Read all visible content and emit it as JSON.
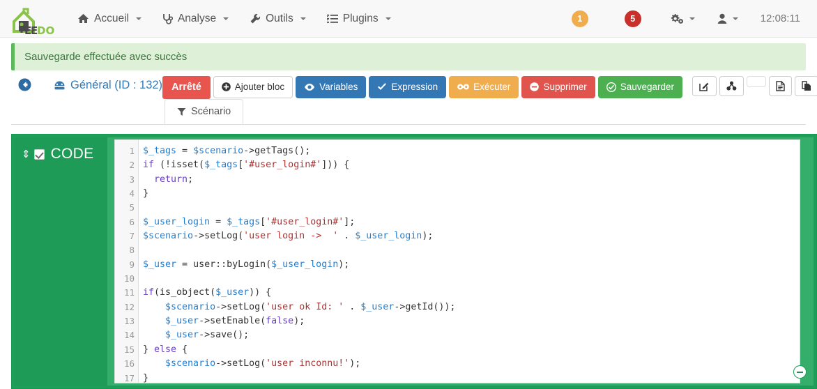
{
  "navbar": {
    "brand": "JEEDOM",
    "brand_part1": "J",
    "brand_part2": "EE",
    "brand_part3": "DOM",
    "items": [
      {
        "label": "Accueil",
        "icon": "home-icon"
      },
      {
        "label": "Analyse",
        "icon": "stethoscope-icon"
      },
      {
        "label": "Outils",
        "icon": "wrench-icon"
      },
      {
        "label": "Plugins",
        "icon": "list-icon"
      }
    ],
    "badges": [
      {
        "value": "1",
        "color": "#f0ad4e",
        "name": "warning-badge"
      },
      {
        "value": "5",
        "color": "#c9302c",
        "name": "error-badge"
      }
    ],
    "settings_icon": "gears-icon",
    "user_icon": "user-icon",
    "clock": "12:08:11"
  },
  "alert": {
    "message": "Sauvegarde effectuée avec succès",
    "bg": "#dff0d8",
    "accent": "#5cb85c"
  },
  "page": {
    "back_icon": "arrow-circle-left-icon",
    "title": "Général (ID : 132)",
    "title_icon": "dashboard-icon"
  },
  "toolbar": {
    "state_label": "Arrêté",
    "add_block_label": "Ajouter bloc",
    "variables_label": "Variables",
    "expression_label": "Expression",
    "execute_label": "Exécuter",
    "delete_label": "Supprimer",
    "save_label": "Sauvegarder",
    "icon_buttons": [
      {
        "name": "edit-icon",
        "glyph": "✎"
      },
      {
        "name": "share-nodes-icon",
        "glyph": "❖"
      },
      {
        "name": "narrow-blank-button",
        "glyph": ""
      },
      {
        "name": "document-icon",
        "glyph": "▤"
      },
      {
        "name": "copy-icon",
        "glyph": "❐"
      },
      {
        "name": "export-icon",
        "glyph": "⛶"
      }
    ],
    "colors": {
      "state": "#e8554e",
      "blue": "#3377b5",
      "orange": "#f0ad4e",
      "red": "#e0544d",
      "green": "#4cb050"
    }
  },
  "tabs": [
    {
      "label": "Scénario",
      "icon": "filter-icon",
      "active": true
    }
  ],
  "block": {
    "title": "CODE",
    "checked": true,
    "drag_icon": "drag-vertical-icon",
    "collapse_icon": "minus-circle-icon",
    "bg_color": "#1e9e5a",
    "accent_color": "#36ae6b"
  },
  "editor": {
    "line_numbers": [
      "1",
      "2",
      "3",
      "4",
      "5",
      "6",
      "7",
      "8",
      "9",
      "10",
      "11",
      "12",
      "13",
      "14",
      "15",
      "16",
      "17"
    ],
    "lines": [
      [
        {
          "t": "$_tags",
          "c": "var"
        },
        {
          "t": " = ",
          "c": "pl"
        },
        {
          "t": "$scenario",
          "c": "var"
        },
        {
          "t": "->getTags();",
          "c": "pl"
        }
      ],
      [
        {
          "t": "if",
          "c": "kw"
        },
        {
          "t": " (!isset(",
          "c": "pl"
        },
        {
          "t": "$_tags",
          "c": "var"
        },
        {
          "t": "[",
          "c": "pl"
        },
        {
          "t": "'#user_login#'",
          "c": "str"
        },
        {
          "t": "])) {",
          "c": "pl"
        }
      ],
      [
        {
          "t": "  ",
          "c": "pl"
        },
        {
          "t": "return",
          "c": "kw"
        },
        {
          "t": ";",
          "c": "pl"
        }
      ],
      [
        {
          "t": "}",
          "c": "pl"
        }
      ],
      [
        {
          "t": "",
          "c": "pl"
        }
      ],
      [
        {
          "t": "$_user_login",
          "c": "var"
        },
        {
          "t": " = ",
          "c": "pl"
        },
        {
          "t": "$_tags",
          "c": "var"
        },
        {
          "t": "[",
          "c": "pl"
        },
        {
          "t": "'#user_login#'",
          "c": "str"
        },
        {
          "t": "];",
          "c": "pl"
        }
      ],
      [
        {
          "t": "$scenario",
          "c": "var"
        },
        {
          "t": "->setLog(",
          "c": "pl"
        },
        {
          "t": "'user login ->  '",
          "c": "str"
        },
        {
          "t": " . ",
          "c": "pl"
        },
        {
          "t": "$_user_login",
          "c": "var"
        },
        {
          "t": ");",
          "c": "pl"
        }
      ],
      [
        {
          "t": "",
          "c": "pl"
        }
      ],
      [
        {
          "t": "$_user",
          "c": "var"
        },
        {
          "t": " = user::byLogin(",
          "c": "pl"
        },
        {
          "t": "$_user_login",
          "c": "var"
        },
        {
          "t": ");",
          "c": "pl"
        }
      ],
      [
        {
          "t": "",
          "c": "pl"
        }
      ],
      [
        {
          "t": "if",
          "c": "kw"
        },
        {
          "t": "(is_object(",
          "c": "pl"
        },
        {
          "t": "$_user",
          "c": "var"
        },
        {
          "t": ")) {",
          "c": "pl"
        }
      ],
      [
        {
          "t": "    ",
          "c": "pl"
        },
        {
          "t": "$scenario",
          "c": "var"
        },
        {
          "t": "->setLog(",
          "c": "pl"
        },
        {
          "t": "'user ok Id: '",
          "c": "str"
        },
        {
          "t": " . ",
          "c": "pl"
        },
        {
          "t": "$_user",
          "c": "var"
        },
        {
          "t": "->getId());",
          "c": "pl"
        }
      ],
      [
        {
          "t": "    ",
          "c": "pl"
        },
        {
          "t": "$_user",
          "c": "var"
        },
        {
          "t": "->setEnable(",
          "c": "pl"
        },
        {
          "t": "false",
          "c": "kw"
        },
        {
          "t": ");",
          "c": "pl"
        }
      ],
      [
        {
          "t": "    ",
          "c": "pl"
        },
        {
          "t": "$_user",
          "c": "var"
        },
        {
          "t": "->save();",
          "c": "pl"
        }
      ],
      [
        {
          "t": "} ",
          "c": "pl"
        },
        {
          "t": "else",
          "c": "kw"
        },
        {
          "t": " {",
          "c": "pl"
        }
      ],
      [
        {
          "t": "    ",
          "c": "pl"
        },
        {
          "t": "$scenario",
          "c": "var"
        },
        {
          "t": "->setLog(",
          "c": "pl"
        },
        {
          "t": "'user inconnu!'",
          "c": "str"
        },
        {
          "t": ");",
          "c": "pl"
        }
      ],
      [
        {
          "t": "}",
          "c": "pl"
        }
      ]
    ],
    "colors": {
      "variable": "#1f7fd4",
      "keyword": "#6a3ec0",
      "string": "#b32d2d",
      "plain": "#333333"
    }
  }
}
